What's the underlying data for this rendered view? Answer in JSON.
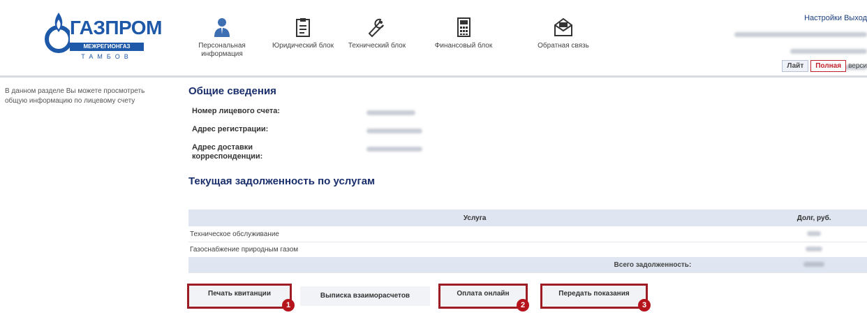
{
  "header": {
    "logo": {
      "brand": "ГАЗПРОМ",
      "subline": "МЕЖРЕГИОНГАЗ",
      "city": "ТАМБОВ"
    },
    "nav": [
      {
        "label": "Персональная\nинформация",
        "icon": "person-icon",
        "active": true
      },
      {
        "label": "Юридический блок",
        "icon": "clipboard-icon"
      },
      {
        "label": "Технический блок",
        "icon": "wrench-icon"
      },
      {
        "label": "Финансовый блок",
        "icon": "calculator-icon"
      },
      {
        "label": "Обратная связь",
        "icon": "envelope-icon"
      }
    ],
    "top_links": {
      "settings": "Настройки",
      "logout": "Выход"
    },
    "version": {
      "lite": "Лайт",
      "full": "Полная",
      "suffix": "верси"
    }
  },
  "sidebar": {
    "note": "В данном разделе Вы можете просмотреть общую информацию по лицевому счету"
  },
  "general": {
    "title": "Общие сведения",
    "fields": [
      {
        "label": "Номер лицевого счета:"
      },
      {
        "label": "Адрес регистрации:"
      },
      {
        "label": "Адрес доставки корреспонденции:"
      }
    ]
  },
  "debt": {
    "title": "Текущая задолженность по услугам",
    "columns": {
      "service": "Услуга",
      "debt": "Долг, руб."
    },
    "rows": [
      {
        "service": "Техническое обслуживание"
      },
      {
        "service": "Газоснабжение природным газом"
      }
    ],
    "total_label": "Всего задолженность:"
  },
  "actions": {
    "print": "Печать квитанции",
    "statement": "Выписка взаиморасчетов",
    "pay": "Оплата онлайн",
    "meter": "Передать показания"
  },
  "badges": [
    "1",
    "2",
    "3"
  ],
  "colors": {
    "brand_blue": "#1e58a8",
    "title_navy": "#1a2f6b",
    "highlight_red": "#9e1c24",
    "badge_red": "#b5141c",
    "table_header": "#dfe6f1"
  }
}
